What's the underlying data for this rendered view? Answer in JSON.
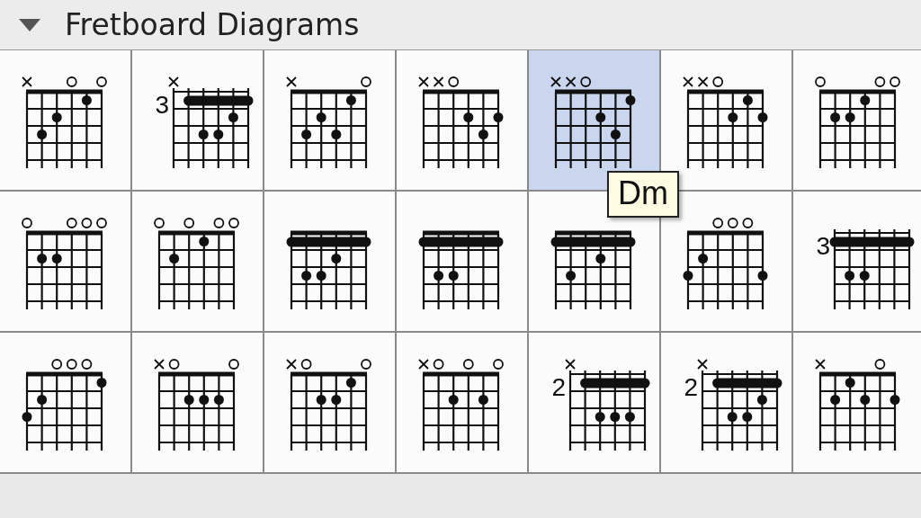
{
  "palette": {
    "title": "Fretboard Diagrams",
    "expanded": true
  },
  "cells": [
    {
      "selected": false,
      "strings": [
        {
          "kind": "muted"
        },
        {
          "kind": "fret3"
        },
        {
          "kind": "fret2"
        },
        {
          "kind": "open"
        },
        {
          "kind": "fret1"
        },
        {
          "kind": "open"
        }
      ]
    },
    {
      "selected": false,
      "fret_label": "3",
      "barre": {
        "kind": "partial"
      },
      "strings": [
        {
          "kind": "muted"
        },
        {
          "kind": "plain"
        },
        {
          "kind": "fret3"
        },
        {
          "kind": "fret3"
        },
        {
          "kind": "fret2"
        },
        {
          "kind": "plain"
        }
      ]
    },
    {
      "selected": false,
      "strings": [
        {
          "kind": "muted"
        },
        {
          "kind": "fret3"
        },
        {
          "kind": "fret2"
        },
        {
          "kind": "fret3"
        },
        {
          "kind": "fret1"
        },
        {
          "kind": "open"
        }
      ]
    },
    {
      "selected": false,
      "strings": [
        {
          "kind": "muted"
        },
        {
          "kind": "muted"
        },
        {
          "kind": "open"
        },
        {
          "kind": "fret2"
        },
        {
          "kind": "fret3"
        },
        {
          "kind": "fret2"
        }
      ]
    },
    {
      "selected": true,
      "strings": [
        {
          "kind": "muted"
        },
        {
          "kind": "muted"
        },
        {
          "kind": "open"
        },
        {
          "kind": "fret2"
        },
        {
          "kind": "fret3"
        },
        {
          "kind": "fret1"
        }
      ]
    },
    {
      "selected": false,
      "strings": [
        {
          "kind": "muted"
        },
        {
          "kind": "muted"
        },
        {
          "kind": "open"
        },
        {
          "kind": "fret2"
        },
        {
          "kind": "fret1"
        },
        {
          "kind": "fret2"
        }
      ]
    },
    {
      "selected": false,
      "strings": [
        {
          "kind": "open"
        },
        {
          "kind": "fret2"
        },
        {
          "kind": "fret2"
        },
        {
          "kind": "fret1"
        },
        {
          "kind": "open"
        },
        {
          "kind": "open"
        }
      ]
    },
    {
      "selected": false,
      "strings": [
        {
          "kind": "open"
        },
        {
          "kind": "fret2"
        },
        {
          "kind": "fret2"
        },
        {
          "kind": "open"
        },
        {
          "kind": "open"
        },
        {
          "kind": "open"
        }
      ]
    },
    {
      "selected": false,
      "strings": [
        {
          "kind": "open"
        },
        {
          "kind": "fret2"
        },
        {
          "kind": "open"
        },
        {
          "kind": "fret1"
        },
        {
          "kind": "open"
        },
        {
          "kind": "open"
        }
      ]
    },
    {
      "selected": false,
      "barre": {
        "kind": "full"
      },
      "strings": [
        {
          "kind": "plain"
        },
        {
          "kind": "fret3"
        },
        {
          "kind": "fret3"
        },
        {
          "kind": "fret2"
        },
        {
          "kind": "plain"
        },
        {
          "kind": "plain"
        }
      ]
    },
    {
      "selected": false,
      "barre": {
        "kind": "full"
      },
      "strings": [
        {
          "kind": "plain"
        },
        {
          "kind": "fret3"
        },
        {
          "kind": "fret3"
        },
        {
          "kind": "plain"
        },
        {
          "kind": "plain"
        },
        {
          "kind": "plain"
        }
      ]
    },
    {
      "selected": false,
      "barre": {
        "kind": "full"
      },
      "strings": [
        {
          "kind": "plain"
        },
        {
          "kind": "fret3"
        },
        {
          "kind": "plain"
        },
        {
          "kind": "fret2"
        },
        {
          "kind": "plain"
        },
        {
          "kind": "plain"
        }
      ]
    },
    {
      "selected": false,
      "strings": [
        {
          "kind": "fret3"
        },
        {
          "kind": "fret2"
        },
        {
          "kind": "open"
        },
        {
          "kind": "open"
        },
        {
          "kind": "open"
        },
        {
          "kind": "fret3"
        }
      ]
    },
    {
      "selected": false,
      "fret_label": "3",
      "barre": {
        "kind": "full"
      },
      "strings": [
        {
          "kind": "plain"
        },
        {
          "kind": "fret3"
        },
        {
          "kind": "fret3"
        },
        {
          "kind": "plain"
        },
        {
          "kind": "plain"
        },
        {
          "kind": "plain"
        }
      ]
    },
    {
      "selected": false,
      "strings": [
        {
          "kind": "fret3"
        },
        {
          "kind": "fret2"
        },
        {
          "kind": "open"
        },
        {
          "kind": "open"
        },
        {
          "kind": "open"
        },
        {
          "kind": "fret1"
        }
      ]
    },
    {
      "selected": false,
      "strings": [
        {
          "kind": "muted"
        },
        {
          "kind": "open"
        },
        {
          "kind": "fret2"
        },
        {
          "kind": "fret2"
        },
        {
          "kind": "fret2"
        },
        {
          "kind": "open"
        }
      ]
    },
    {
      "selected": false,
      "strings": [
        {
          "kind": "muted"
        },
        {
          "kind": "open"
        },
        {
          "kind": "fret2"
        },
        {
          "kind": "fret2"
        },
        {
          "kind": "fret1"
        },
        {
          "kind": "open"
        }
      ]
    },
    {
      "selected": false,
      "strings": [
        {
          "kind": "muted"
        },
        {
          "kind": "open"
        },
        {
          "kind": "fret2"
        },
        {
          "kind": "open"
        },
        {
          "kind": "fret2"
        },
        {
          "kind": "open"
        }
      ]
    },
    {
      "selected": false,
      "fret_label": "2",
      "barre": {
        "kind": "partial"
      },
      "strings": [
        {
          "kind": "muted"
        },
        {
          "kind": "plain"
        },
        {
          "kind": "fret3"
        },
        {
          "kind": "fret3"
        },
        {
          "kind": "fret3"
        },
        {
          "kind": "plain"
        }
      ]
    },
    {
      "selected": false,
      "fret_label": "2",
      "barre": {
        "kind": "partial"
      },
      "strings": [
        {
          "kind": "muted"
        },
        {
          "kind": "plain"
        },
        {
          "kind": "fret3"
        },
        {
          "kind": "fret3"
        },
        {
          "kind": "fret2"
        },
        {
          "kind": "plain"
        }
      ]
    },
    {
      "selected": false,
      "strings": [
        {
          "kind": "muted"
        },
        {
          "kind": "fret2"
        },
        {
          "kind": "fret1"
        },
        {
          "kind": "fret2"
        },
        {
          "kind": "open"
        },
        {
          "kind": "fret2"
        }
      ]
    }
  ],
  "tooltip": {
    "text": "Dm"
  }
}
